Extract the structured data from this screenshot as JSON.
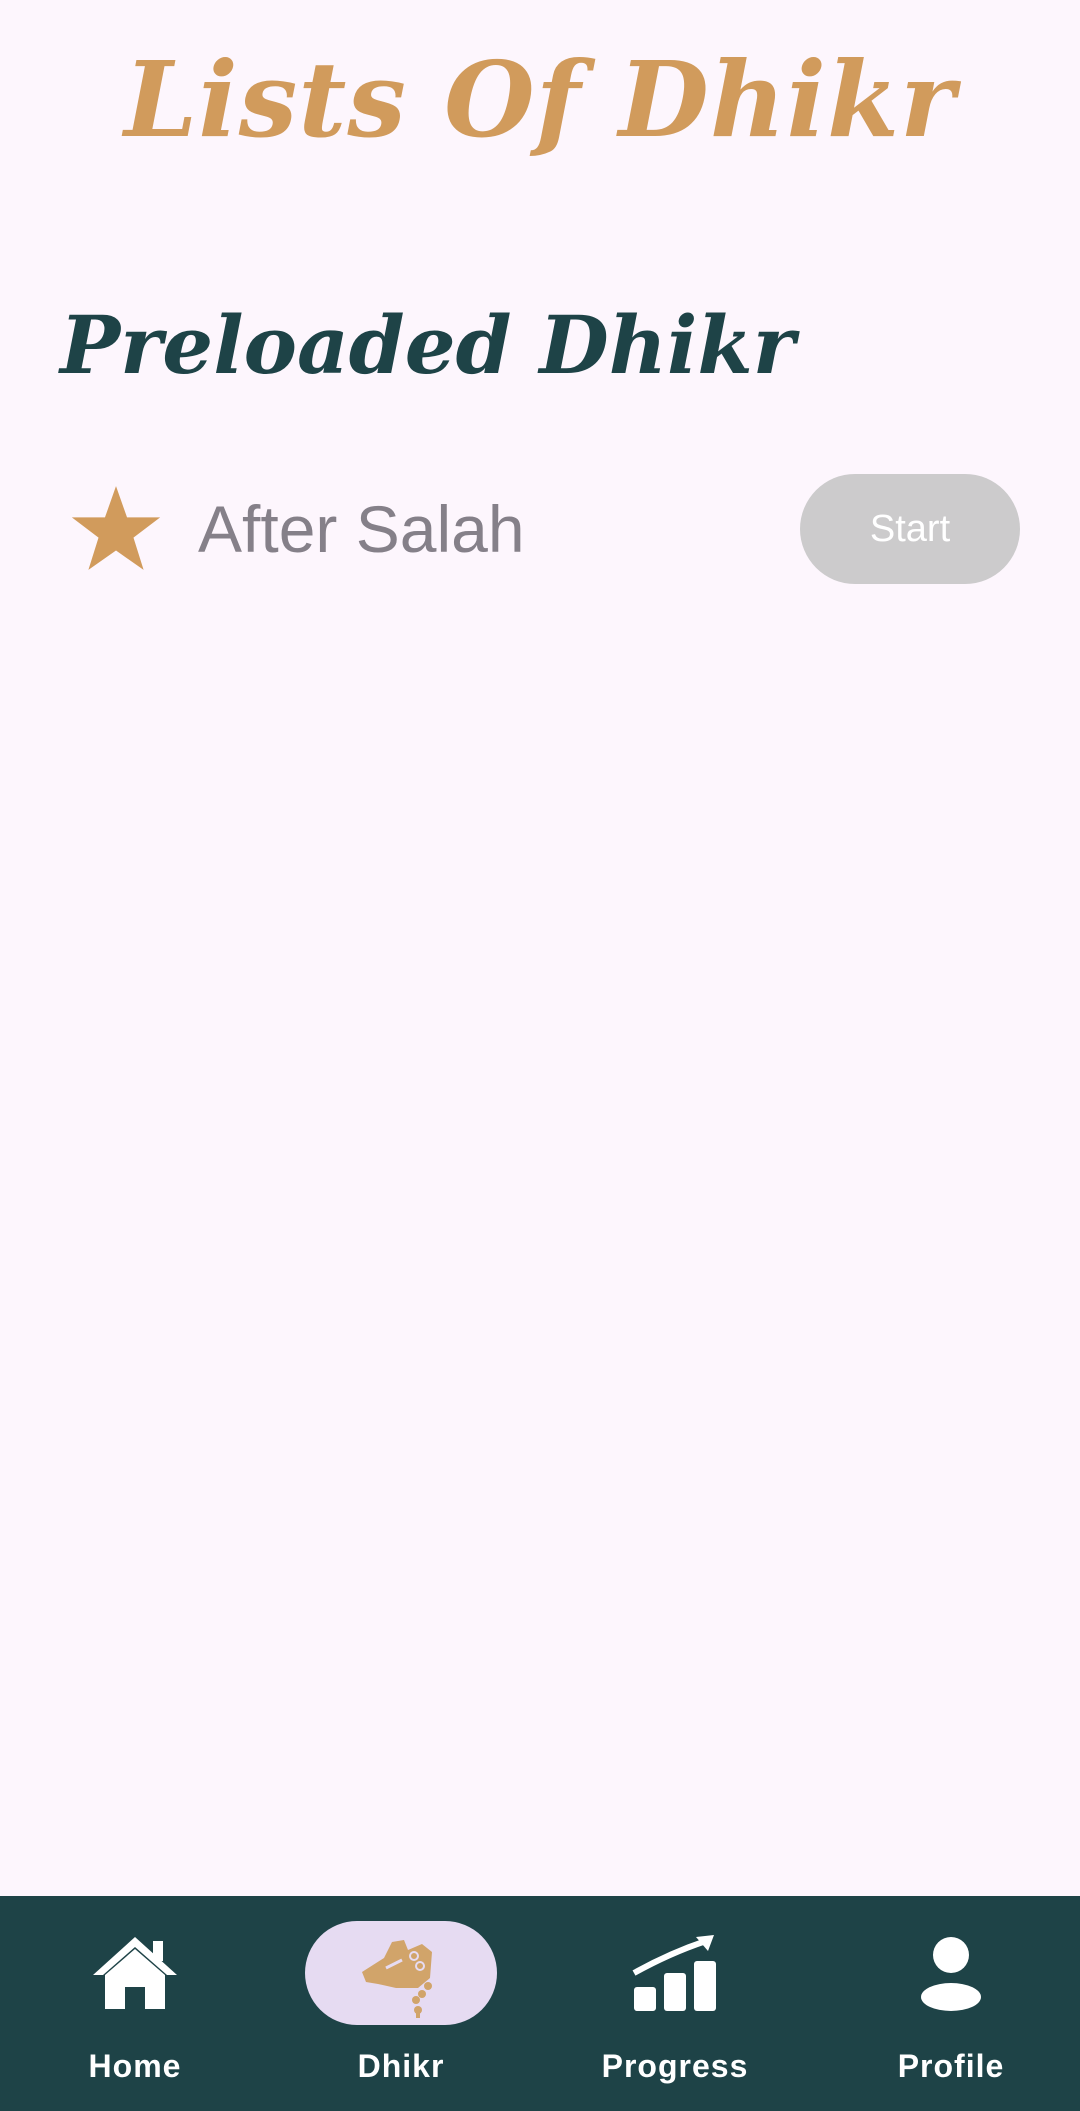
{
  "header": {
    "title": "Lists Of Dhikr"
  },
  "section": {
    "title": "Preloaded Dhikr"
  },
  "dhikr_list": [
    {
      "icon": "star-icon",
      "label": "After Salah",
      "button_label": "Start"
    }
  ],
  "bottom_nav": {
    "items": [
      {
        "label": "Home",
        "icon": "home-icon",
        "active": false
      },
      {
        "label": "Dhikr",
        "icon": "prayer-beads-hand-icon",
        "active": true
      },
      {
        "label": "Progress",
        "icon": "progress-chart-icon",
        "active": false
      },
      {
        "label": "Profile",
        "icon": "profile-icon",
        "active": false
      }
    ]
  },
  "colors": {
    "background": "#fdf6fd",
    "accent_gold": "#d19b5c",
    "dark_teal": "#1e4347",
    "button_disabled": "#cccbcc",
    "label_gray": "#858089",
    "active_pill": "#e6dbf2"
  }
}
